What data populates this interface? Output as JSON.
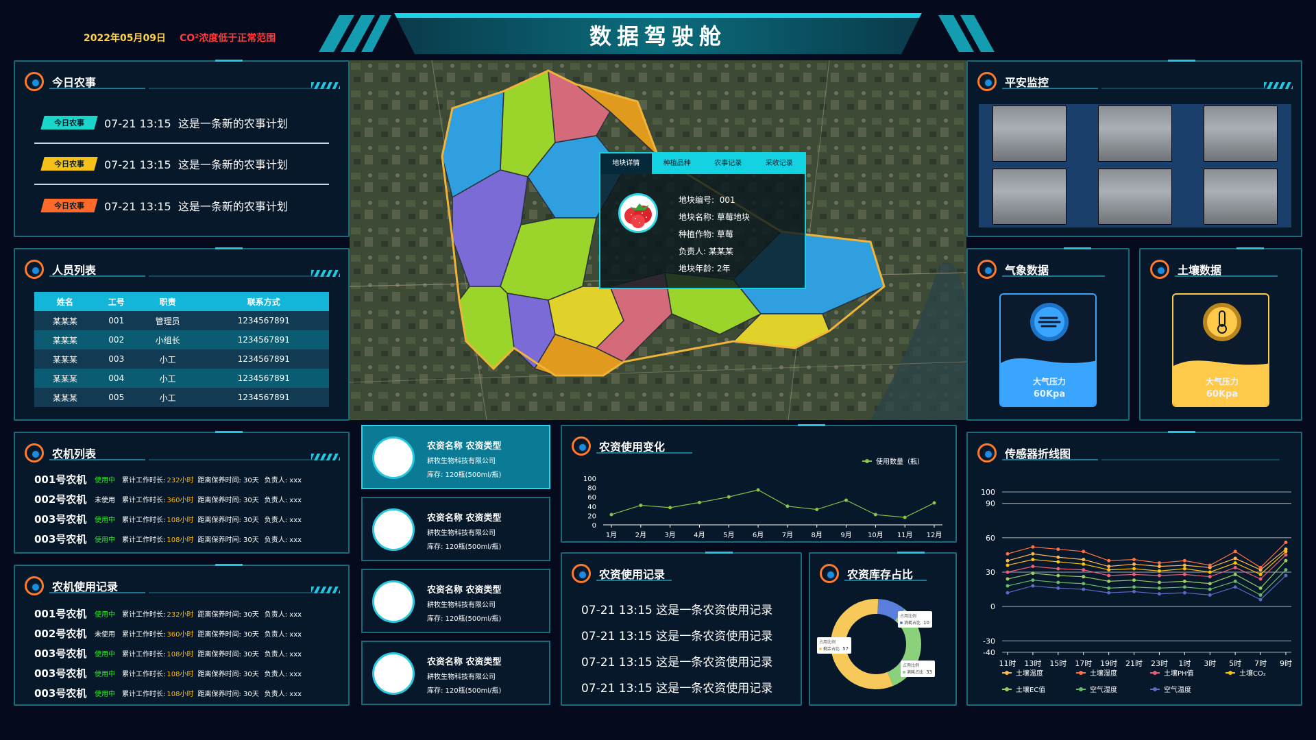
{
  "header": {
    "date": "2022年05月09日",
    "alert": "CO²浓度低于正常范围",
    "title": "数据驾驶舱"
  },
  "farm_today": {
    "title": "今日农事",
    "items": [
      {
        "tag": "今日农事",
        "time": "07-21 13:15",
        "text": "这是一条新的农事计划",
        "color": "#19d6c9"
      },
      {
        "tag": "今日农事",
        "time": "07-21 13:15",
        "text": "这是一条新的农事计划",
        "color": "#f6c01a"
      },
      {
        "tag": "今日农事",
        "time": "07-21 13:15",
        "text": "这是一条新的农事计划",
        "color": "#ff6a2b"
      }
    ]
  },
  "personnel": {
    "title": "人员列表",
    "columns": [
      "姓名",
      "工号",
      "职责",
      "联系方式"
    ],
    "rows": [
      [
        "某某某",
        "001",
        "管理员",
        "1234567891"
      ],
      [
        "某某某",
        "002",
        "小组长",
        "1234567891"
      ],
      [
        "某某某",
        "003",
        "小工",
        "1234567891"
      ],
      [
        "某某某",
        "004",
        "小工",
        "1234567891"
      ],
      [
        "某某某",
        "005",
        "小工",
        "1234567891"
      ]
    ]
  },
  "machines": {
    "title": "农机列表",
    "rows": [
      {
        "name": "001号农机",
        "status": "使用中",
        "status_color": "#2ee62e",
        "l1": "累计工作时长:",
        "hours": "232小时",
        "l2": "距离保养时间: 30天",
        "l3": "负责人: xxx"
      },
      {
        "name": "002号农机",
        "status": "未使用",
        "status_color": "#ffffff",
        "l1": "累计工作时长:",
        "hours": "360小时",
        "l2": "距离保养时间: 30天",
        "l3": "负责人: xxx"
      },
      {
        "name": "003号农机",
        "status": "使用中",
        "status_color": "#2ee62e",
        "l1": "累计工作时长:",
        "hours": "108小时",
        "l2": "距离保养时间: 30天",
        "l3": "负责人: xxx"
      },
      {
        "name": "003号农机",
        "status": "使用中",
        "status_color": "#2ee62e",
        "l1": "累计工作时长:",
        "hours": "108小时",
        "l2": "距离保养时间: 30天",
        "l3": "负责人: xxx"
      }
    ]
  },
  "machine_usage": {
    "title": "农机使用记录",
    "rows": [
      {
        "name": "001号农机",
        "status": "使用中",
        "status_color": "#2ee62e",
        "l1": "累计工作时长:",
        "hours": "232小时",
        "l2": "距离保养时间: 30天",
        "l3": "负责人: xxx"
      },
      {
        "name": "002号农机",
        "status": "未使用",
        "status_color": "#ffffff",
        "l1": "累计工作时长:",
        "hours": "360小时",
        "l2": "距离保养时间: 30天",
        "l3": "负责人: xxx"
      },
      {
        "name": "003号农机",
        "status": "使用中",
        "status_color": "#2ee62e",
        "l1": "累计工作时长:",
        "hours": "108小时",
        "l2": "距离保养时间: 30天",
        "l3": "负责人: xxx"
      },
      {
        "name": "003号农机",
        "status": "使用中",
        "status_color": "#2ee62e",
        "l1": "累计工作时长:",
        "hours": "108小时",
        "l2": "距离保养时间: 30天",
        "l3": "负责人: xxx"
      },
      {
        "name": "003号农机",
        "status": "使用中",
        "status_color": "#2ee62e",
        "l1": "累计工作时长:",
        "hours": "108小时",
        "l2": "距离保养时间: 30天",
        "l3": "负责人: xxx"
      }
    ]
  },
  "map_popup": {
    "tabs": [
      "地块详情",
      "种植品种",
      "农事记录",
      "采收记录"
    ],
    "plot_no_label": "地块编号:",
    "plot_no": "001",
    "plot_name_label": "地块名称:",
    "plot_name": "草莓地块",
    "crop_label": "种植作物:",
    "crop": "草莓",
    "owner_label": "负责人:",
    "owner": "某某某",
    "age_label": "地块年龄:",
    "age": "2年"
  },
  "security": {
    "title": "平安监控"
  },
  "weather": {
    "title": "气象数据",
    "label": "大气压力",
    "value": "60Kpa",
    "color": "#3aa5ff"
  },
  "soil": {
    "title": "土壤数据",
    "label": "大气压力",
    "value": "60Kpa",
    "color": "#ffc94a"
  },
  "agri_items": [
    {
      "l1": "农资名称   农资类型",
      "l2": "耕牧生物科技有限公司",
      "l3": "库存: 120瓶(500ml/瓶)"
    },
    {
      "l1": "农资名称   农资类型",
      "l2": "耕牧生物科技有限公司",
      "l3": "库存: 120瓶(500ml/瓶)"
    },
    {
      "l1": "农资名称   农资类型",
      "l2": "耕牧生物科技有限公司",
      "l3": "库存: 120瓶(500ml/瓶)"
    },
    {
      "l1": "农资名称   农资类型",
      "l2": "耕牧生物科技有限公司",
      "l3": "库存: 120瓶(500ml/瓶)"
    }
  ],
  "agri_change": {
    "title": "农资使用变化",
    "chart_data": {
      "type": "line",
      "categories": [
        "1月",
        "2月",
        "3月",
        "4月",
        "5月",
        "6月",
        "7月",
        "8月",
        "9月",
        "10月",
        "11月",
        "12月"
      ],
      "series": [
        {
          "name": "使用数量（瓶）",
          "values": [
            22,
            42,
            37,
            48,
            60,
            75,
            40,
            33,
            53,
            22,
            16,
            47
          ]
        }
      ],
      "ylim": [
        0,
        100
      ],
      "yticks": [
        0,
        20,
        40,
        60,
        80,
        100
      ],
      "color": "#8bc34a"
    }
  },
  "agri_records": {
    "title": "农资使用记录",
    "rows": [
      "07-21 13:15  这是一条农资使用记录",
      "07-21 13:15  这是一条农资使用记录",
      "07-21 13:15  这是一条农资使用记录",
      "07-21 13:15  这是一条农资使用记录"
    ]
  },
  "stock_ratio": {
    "title": "农资库存占比",
    "chart_data": {
      "type": "pie",
      "slices": [
        {
          "name": "剩余占比",
          "value": 57,
          "color": "#f7c85a"
        },
        {
          "name": "消耗占比",
          "value": 33,
          "color": "#8bd17c"
        },
        {
          "name": "消耗占比",
          "value": 10,
          "color": "#5a7fdc"
        }
      ],
      "labels": [
        {
          "title": "占用比例",
          "name": "消耗占比",
          "value": "10"
        },
        {
          "title": "占用比例",
          "name": "剩余占比",
          "value": "57"
        },
        {
          "title": "占用比例",
          "name": "消耗占比",
          "value": "33"
        }
      ]
    }
  },
  "sensor": {
    "title": "传感器折线图",
    "chart_data": {
      "type": "line",
      "categories": [
        "11时",
        "13时",
        "15时",
        "17时",
        "19时",
        "21时",
        "23时",
        "1时",
        "3时",
        "5时",
        "7时",
        "9时"
      ],
      "ylim": [
        -40,
        100
      ],
      "yticks": [
        100,
        90,
        60,
        30,
        0,
        -30,
        -40
      ],
      "series": [
        {
          "name": "土壤温度",
          "color": "#ffb74d",
          "values": [
            40,
            46,
            43,
            41,
            35,
            37,
            35,
            36,
            34,
            42,
            32,
            50
          ]
        },
        {
          "name": "土壤湿度",
          "color": "#ff7043",
          "values": [
            46,
            52,
            50,
            48,
            40,
            41,
            38,
            40,
            36,
            48,
            34,
            56
          ]
        },
        {
          "name": "土壤PH值",
          "color": "#ef5b7a",
          "values": [
            30,
            35,
            33,
            32,
            27,
            28,
            27,
            28,
            26,
            34,
            24,
            45
          ]
        },
        {
          "name": "土壤CO₂",
          "color": "#ffc107",
          "values": [
            36,
            41,
            39,
            37,
            32,
            33,
            31,
            33,
            30,
            38,
            28,
            48
          ]
        },
        {
          "name": "土壤EC值",
          "color": "#9ccc65",
          "values": [
            24,
            29,
            27,
            26,
            22,
            23,
            21,
            22,
            20,
            28,
            16,
            40
          ]
        },
        {
          "name": "空气湿度",
          "color": "#66bb6a",
          "values": [
            18,
            23,
            21,
            20,
            16,
            17,
            16,
            17,
            15,
            22,
            10,
            32
          ]
        },
        {
          "name": "空气温度",
          "color": "#5c6bc0",
          "values": [
            12,
            18,
            16,
            15,
            12,
            13,
            11,
            12,
            10,
            17,
            6,
            27
          ]
        }
      ]
    }
  }
}
